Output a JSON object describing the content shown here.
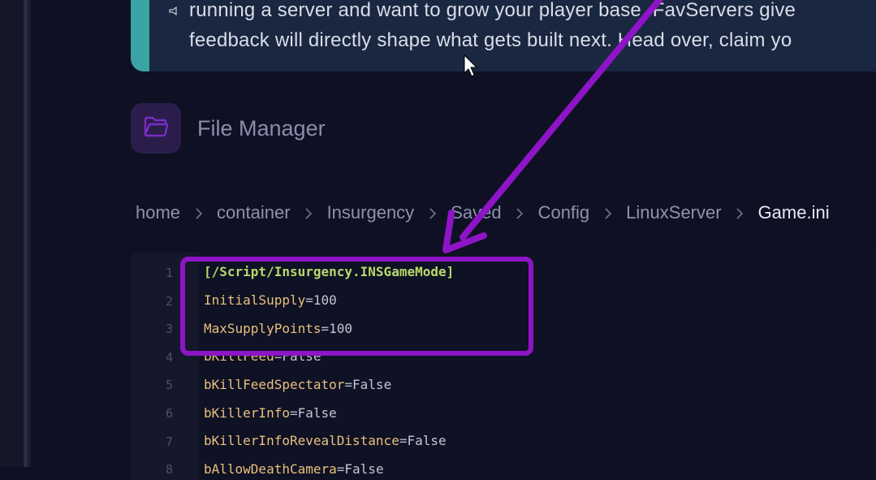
{
  "notice": {
    "icon": "megaphone-icon",
    "line1": "running a server and want to grow your player base, FavServers give",
    "line2": "feedback will directly shape what gets built next. Head over, claim yo"
  },
  "file_manager": {
    "icon": "folder-open-icon",
    "title": "File Manager"
  },
  "breadcrumb": {
    "items": [
      "home",
      "container",
      "Insurgency",
      "Saved",
      "Config",
      "LinuxServer",
      "Game.ini"
    ]
  },
  "editor": {
    "lines": [
      {
        "num": "1",
        "key": "[/Script/Insurgency.INSGameMode]",
        "eq": "",
        "value": ""
      },
      {
        "num": "2",
        "key": "InitialSupply",
        "eq": "=",
        "value": "100"
      },
      {
        "num": "3",
        "key": "MaxSupplyPoints",
        "eq": "=",
        "value": "100"
      },
      {
        "num": "4",
        "key": "bKillFeed",
        "eq": "=",
        "value": "False"
      },
      {
        "num": "5",
        "key": "bKillFeedSpectator",
        "eq": "=",
        "value": "False"
      },
      {
        "num": "6",
        "key": "bKillerInfo",
        "eq": "=",
        "value": "False"
      },
      {
        "num": "7",
        "key": "bKillerInfoRevealDistance",
        "eq": "=",
        "value": "False"
      },
      {
        "num": "8",
        "key": "bAllowDeathCamera",
        "eq": "=",
        "value": "False"
      }
    ]
  },
  "colors": {
    "page_bg": "#0f1024",
    "notice_bg": "#1a2740",
    "notice_accent": "#3aa3a3",
    "icon_box_bg": "#2a1d4b",
    "folder_icon": "#7b2cc4",
    "annotation": "#8e14c7",
    "section_header": "#b8d96a",
    "ini_key": "#e8c07d"
  }
}
